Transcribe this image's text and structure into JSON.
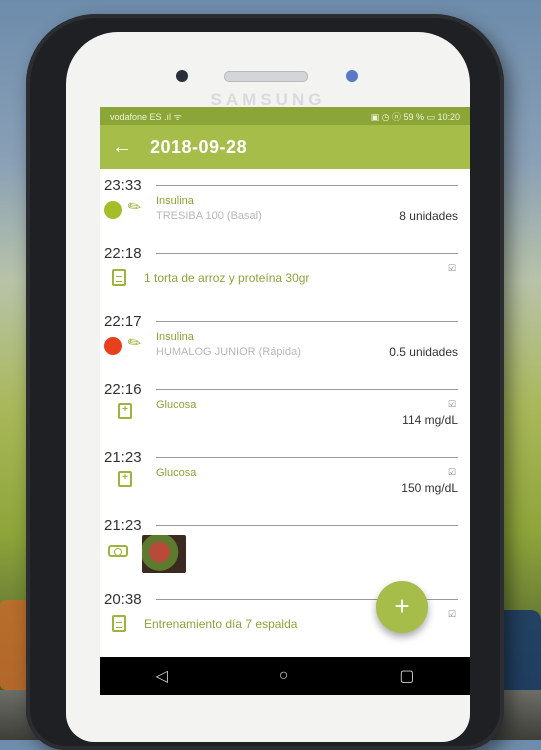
{
  "phone": {
    "brand": "SAMSUNG"
  },
  "status_bar": {
    "left": "vodafone ES .ıl ᯤ",
    "right": "▣ ◷ ⓝ 59 % ▭ 10:20"
  },
  "app_bar": {
    "back_icon": "←",
    "title": "2018-09-28"
  },
  "entries": [
    {
      "time": "23:33",
      "kind": "insulin",
      "dot_color": "#a6bd2a",
      "type": "Insulina",
      "detail": "TRESIBA 100 (Basal)",
      "amount": "8 unidades"
    },
    {
      "time": "22:18",
      "kind": "note",
      "text": "1 torta de arroz y proteína 30gr",
      "edit_icon": "☑"
    },
    {
      "time": "22:17",
      "kind": "insulin",
      "dot_color": "#e8401c",
      "type": "Insulina",
      "detail": "HUMALOG JUNIOR (Rápida)",
      "amount": "0.5 unidades"
    },
    {
      "time": "22:16",
      "kind": "glucose",
      "type": "Glucosa",
      "amount": "114 mg/dL",
      "edit_icon": "☑"
    },
    {
      "time": "21:23",
      "kind": "glucose",
      "type": "Glucosa",
      "amount": "150 mg/dL",
      "edit_icon": "☑"
    },
    {
      "time": "21:23",
      "kind": "photo"
    },
    {
      "time": "20:38",
      "kind": "note",
      "text": "Entrenamiento día 7 espalda",
      "edit_icon": "☑"
    }
  ],
  "fab": {
    "label": "+"
  },
  "nav": {
    "back": "◁",
    "home": "○",
    "recent": "▢"
  },
  "colors": {
    "accent": "#a6bd4a",
    "status": "#8ba637"
  }
}
